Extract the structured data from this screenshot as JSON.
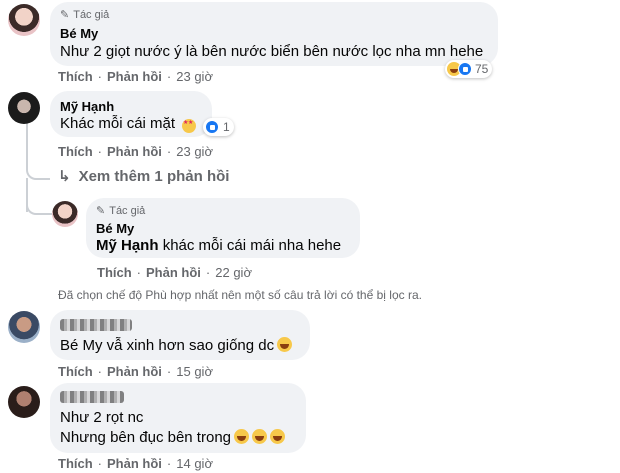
{
  "comments": [
    {
      "author_badge": "Tác giả",
      "name": "Bé My",
      "text": "Như 2 giọt nước ý là bên nước biển bên nước lọc nha mn hehe",
      "reaction_count": "75",
      "like": "Thích",
      "reply": "Phản hồi",
      "time": "23 giờ"
    },
    {
      "name": "Mỹ Hạnh",
      "text": "Khác mỗi cái mặt",
      "reaction_count": "1",
      "like": "Thích",
      "reply": "Phản hồi",
      "time": "23 giờ"
    },
    {
      "name": "",
      "text": "Bé My vẫ xinh hơn sao giống dc",
      "like": "Thích",
      "reply": "Phản hồi",
      "time": "15 giờ"
    },
    {
      "name": "",
      "text_line1": "Như 2 rọt nc",
      "text_line2": "Nhưng bên đục bên trong",
      "like": "Thích",
      "reply": "Phản hồi",
      "time": "14 giờ"
    }
  ],
  "view_more_replies": "Xem thêm 1 phản hồi",
  "reply": {
    "author_badge": "Tác giả",
    "name": "Bé My",
    "mention": "Mỹ Hạnh",
    "text": "khác mỗi cái mái nha hehe",
    "like": "Thích",
    "reply": "Phản hồi",
    "time": "22 giờ"
  },
  "filter_notice": "Đã chọn chế độ Phù hợp nhất nên một số câu trả lời có thể bị lọc ra.",
  "colors": {
    "bubble": "#f0f2f5",
    "meta_text": "#65676b",
    "like_blue": "#1877f2",
    "thread_line": "#ccd0d5"
  }
}
